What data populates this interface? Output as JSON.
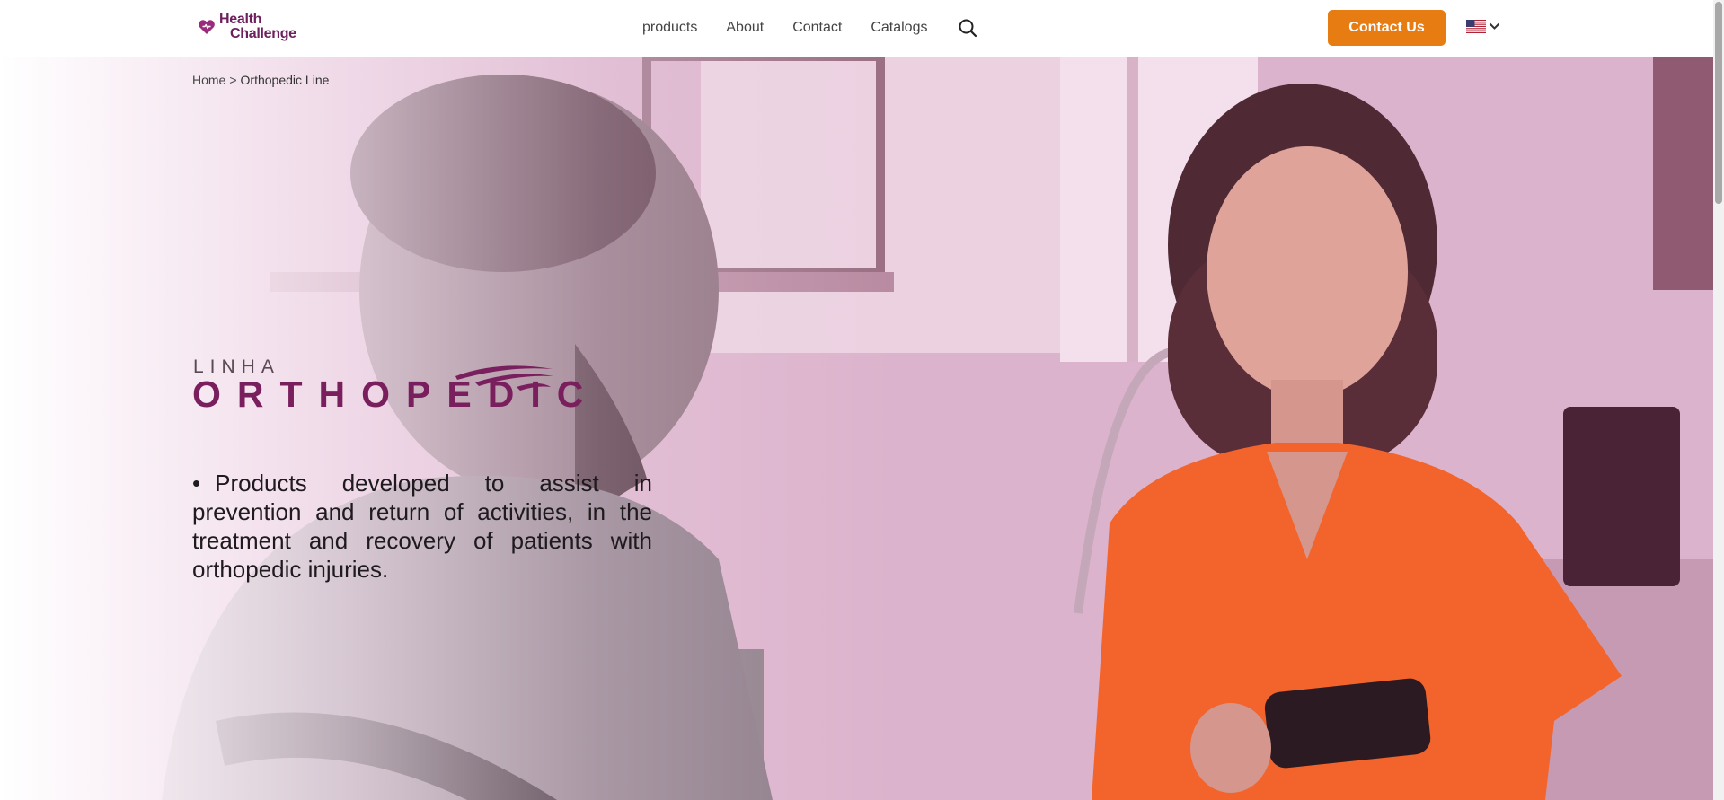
{
  "header": {
    "logo": {
      "line1": "Health",
      "line2": "Challenge"
    },
    "nav": [
      {
        "label": "products"
      },
      {
        "label": "About"
      },
      {
        "label": "Contact"
      },
      {
        "label": "Catalogs"
      }
    ],
    "search_icon": "search-icon",
    "cta_label": "Contact Us",
    "language_icon": "us-flag-icon"
  },
  "breadcrumb": {
    "home": "Home",
    "separator": ">",
    "current": "Orthopedic Line"
  },
  "hero": {
    "brand_small": "LINHA",
    "brand_large": "ORTHOPEDIC",
    "bullet": "•",
    "description": "Products developed to assist in prevention and return of activities, in the treatment and recovery of patients with orthopedic injuries."
  },
  "colors": {
    "brand": "#7a1f5e",
    "accent": "#e77c13",
    "hero_tint": "#dcb3cc"
  }
}
